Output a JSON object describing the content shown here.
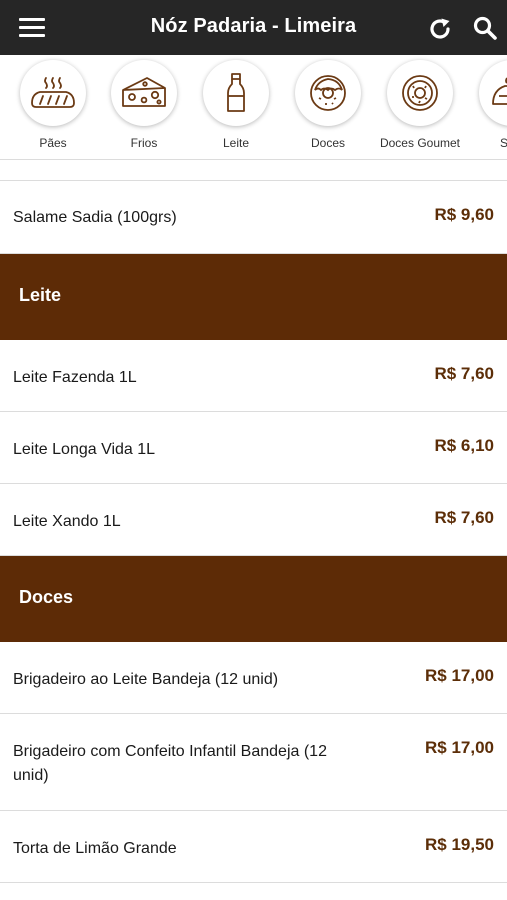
{
  "header": {
    "title": "Nóz Padaria - Limeira"
  },
  "categories": [
    {
      "label": "Pães",
      "icon": "bread-icon"
    },
    {
      "label": "Frios",
      "icon": "cheese-icon"
    },
    {
      "label": "Leite",
      "icon": "milk-bottle-icon"
    },
    {
      "label": "Doces",
      "icon": "donut-icon"
    },
    {
      "label": "Doces Goumet",
      "icon": "gourmet-donut-icon"
    },
    {
      "label": "Salg",
      "icon": "savory-icon"
    }
  ],
  "list": {
    "partial_item": {
      "name": "Salame Sadia (100grs)",
      "price": "R$ 9,60"
    },
    "sections": [
      {
        "title": "Leite",
        "items": [
          {
            "name": "Leite Fazenda 1L",
            "price": "R$ 7,60"
          },
          {
            "name": "Leite Longa Vida 1L",
            "price": "R$ 6,10"
          },
          {
            "name": "Leite Xando 1L",
            "price": "R$ 7,60"
          }
        ]
      },
      {
        "title": "Doces",
        "items": [
          {
            "name": "Brigadeiro ao Leite Bandeja (12 unid)",
            "price": "R$ 17,00"
          },
          {
            "name": "Brigadeiro com Confeito Infantil Bandeja (12 unid)",
            "price": "R$ 17,00"
          },
          {
            "name": "Torta de Limão Grande",
            "price": "R$ 19,50"
          }
        ]
      }
    ]
  },
  "colors": {
    "topbar": "#262626",
    "section": "#5d2b06",
    "price": "#5c2e08",
    "icon_stroke": "#6b3a14"
  }
}
